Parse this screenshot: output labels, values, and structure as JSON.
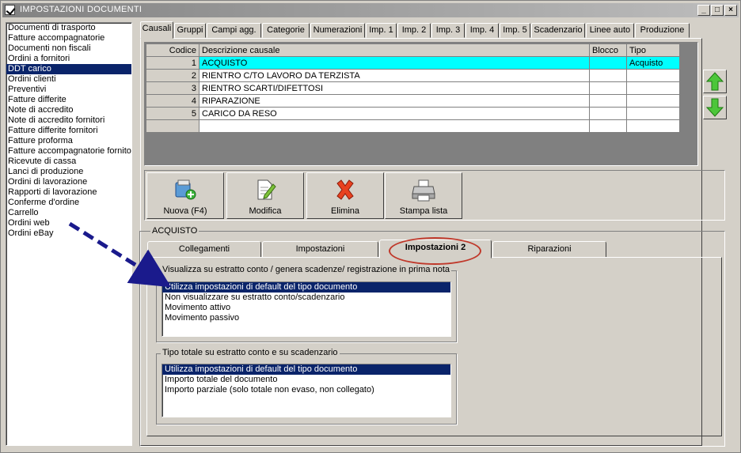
{
  "window": {
    "title": "IMPOSTAZIONI DOCUMENTI",
    "minimize": "_",
    "maximize": "□",
    "close": "×"
  },
  "doc_types": [
    "Documenti di trasporto",
    "Fatture accompagnatorie",
    "Documenti non fiscali",
    "Ordini a fornitori",
    "DDT carico",
    "Ordini clienti",
    "Preventivi",
    "Fatture differite",
    "Note di accredito",
    "Note di accredito fornitori",
    "Fatture differite fornitori",
    "Fatture proforma",
    "Fatture accompagnatorie fornitori",
    "Ricevute di cassa",
    "Lanci di produzione",
    "Ordini di lavorazione",
    "Rapporti di lavorazione",
    "Conferme d'ordine",
    "Carrello",
    "Ordini web",
    "Ordini eBay"
  ],
  "selected_doc_type": "DDT carico",
  "tabs": [
    "Causali",
    "Gruppi",
    "Campi agg.",
    "Categorie",
    "Numerazioni",
    "Imp. 1",
    "Imp. 2",
    "Imp. 3",
    "Imp. 4",
    "Imp. 5",
    "Scadenzario",
    "Linee auto",
    "Produzione"
  ],
  "active_tab": "Causali",
  "grid": {
    "headers": {
      "code": "Codice",
      "desc": "Descrizione causale",
      "block": "Blocco",
      "type": "Tipo"
    },
    "rows": [
      {
        "code": "1",
        "desc": "ACQUISTO",
        "block": "",
        "type": "Acquisto"
      },
      {
        "code": "2",
        "desc": "RIENTRO C/TO LAVORO DA TERZISTA",
        "block": "",
        "type": ""
      },
      {
        "code": "3",
        "desc": "RIENTRO SCARTI/DIFETTOSI",
        "block": "",
        "type": ""
      },
      {
        "code": "4",
        "desc": "RIPARAZIONE",
        "block": "",
        "type": ""
      },
      {
        "code": "5",
        "desc": "CARICO DA RESO",
        "block": "",
        "type": ""
      }
    ]
  },
  "toolbar": {
    "new": "Nuova (F4)",
    "edit": "Modifica",
    "delete": "Elimina",
    "print": "Stampa lista"
  },
  "detail": {
    "group_title": "ACQUISTO",
    "subtabs": [
      "Collegamenti",
      "Impostazioni",
      "Impostazioni 2",
      "Riparazioni"
    ],
    "active_subtab": "Impostazioni 2",
    "section1": {
      "label": "Visualizza su estratto conto / genera scadenze/ registrazione  in prima nota",
      "options": [
        "Utilizza impostazioni di default del tipo documento",
        "Non visualizzare su estratto conto/scadenzario",
        "Movimento attivo",
        "Movimento passivo"
      ],
      "selected": 0
    },
    "section2": {
      "label": "Tipo totale su estratto conto e su scadenzario",
      "options": [
        "Utilizza impostazioni di default del tipo documento",
        "Importo totale del documento",
        "Importo parziale (solo totale non evaso, non collegato)"
      ],
      "selected": 0
    }
  },
  "colors": {
    "selection": "#0a246a",
    "highlight_row": "#00ffff",
    "annotation_oval": "#c0392b",
    "annotation_arrow": "#1a1a8c"
  }
}
